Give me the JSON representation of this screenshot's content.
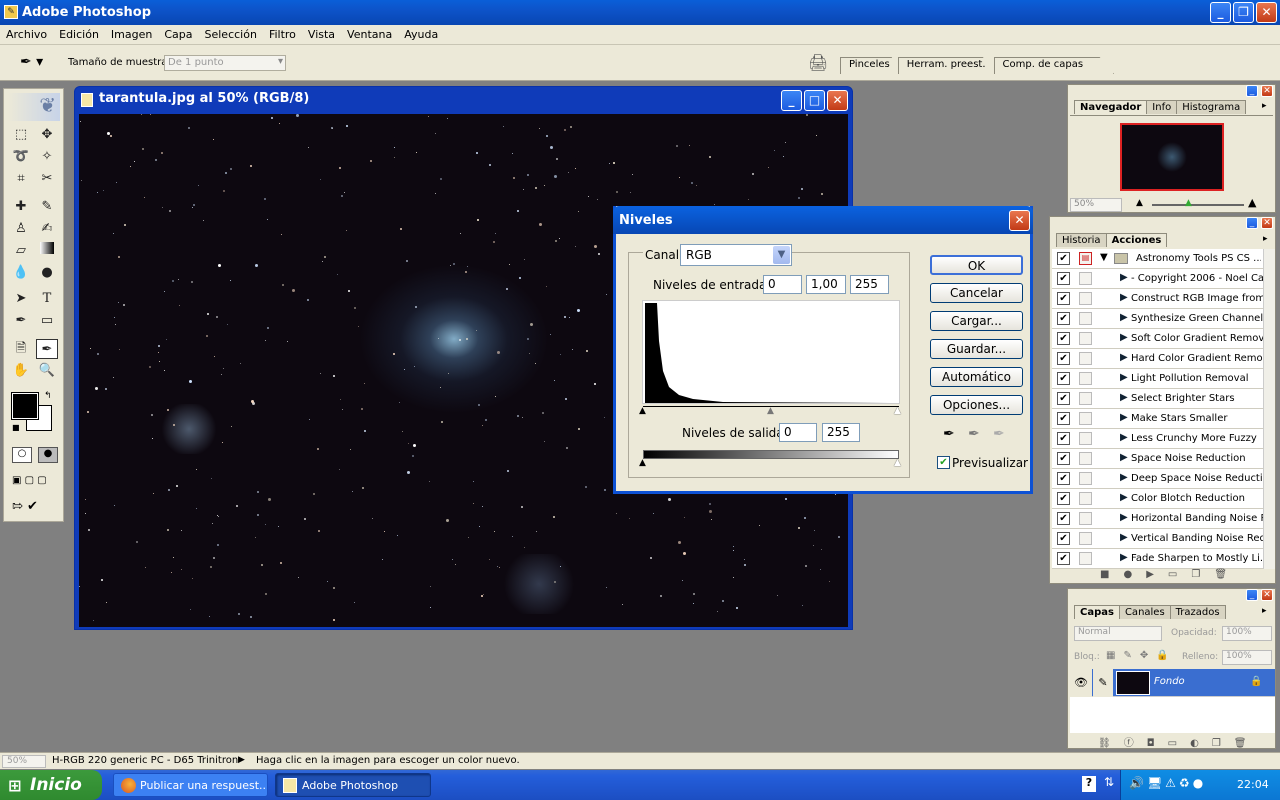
{
  "app": {
    "title": "Adobe Photoshop"
  },
  "menu": [
    "Archivo",
    "Edición",
    "Imagen",
    "Capa",
    "Selección",
    "Filtro",
    "Vista",
    "Ventana",
    "Ayuda"
  ],
  "options_bar": {
    "sample_size_label": "Tamaño de muestra:",
    "sample_size_value": "De 1 punto"
  },
  "palette_well": {
    "tabs": [
      "Pinceles",
      "Herram. preest.",
      "Comp. de capas"
    ]
  },
  "document": {
    "title": "tarantula.jpg al 50% (RGB/8)"
  },
  "levels_dialog": {
    "title": "Niveles",
    "channel_label": "Canal:",
    "channel_value": "RGB",
    "input_label": "Niveles de entrada:",
    "input_black": "0",
    "input_gamma": "1,00",
    "input_white": "255",
    "output_label": "Niveles de salida:",
    "output_black": "0",
    "output_white": "255",
    "buttons": {
      "ok": "OK",
      "cancel": "Cancelar",
      "load": "Cargar...",
      "save": "Guardar...",
      "auto": "Automático",
      "options": "Opciones..."
    },
    "preview_label": "Previsualizar",
    "preview_checked": true
  },
  "navigator": {
    "tabs": [
      "Navegador",
      "Info",
      "Histograma"
    ],
    "zoom": "50%"
  },
  "actions_panel": {
    "tabs": [
      "Historia",
      "Acciones"
    ],
    "set_name": "Astronomy Tools PS CS ...",
    "items": [
      "- Copyright 2006 - Noel Ca...",
      "Construct RGB Image from...",
      "Synthesize Green Channel ...",
      "Soft Color Gradient Removal",
      "Hard Color Gradient Remo...",
      "Light Pollution Removal",
      "Select Brighter Stars",
      "Make Stars Smaller",
      "Less Crunchy More Fuzzy",
      "Space Noise Reduction",
      "Deep Space Noise Reduction",
      "Color Blotch Reduction",
      "Horizontal Banding Noise R...",
      "Vertical Banding Noise Red...",
      "Fade Sharpen to Mostly Li..."
    ]
  },
  "layers_panel": {
    "tabs": [
      "Capas",
      "Canales",
      "Trazados"
    ],
    "blend_mode": "Normal",
    "opacity_label": "Opacidad:",
    "opacity_value": "100%",
    "lock_label": "Bloq.:",
    "fill_label": "Relleno:",
    "fill_value": "100%",
    "layer_name": "Fondo"
  },
  "status_bar": {
    "zoom": "50%",
    "profile": "H-RGB 220 generic PC - D65 Trinitron",
    "hint": "Haga clic en la imagen para escoger un color nuevo."
  },
  "taskbar": {
    "start": "Inicio",
    "buttons": [
      "Publicar una respuest...",
      "Adobe Photoshop"
    ],
    "clock": "22:04"
  }
}
